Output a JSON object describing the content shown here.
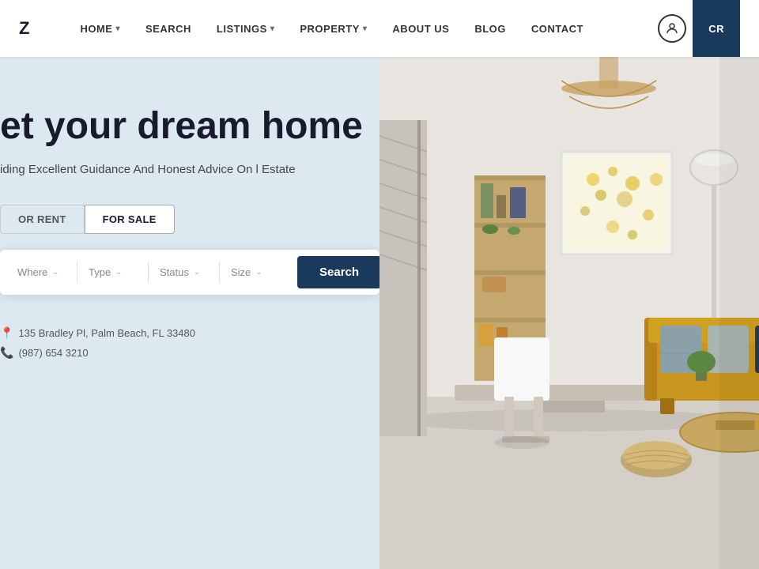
{
  "brand": {
    "logo": "Z"
  },
  "navbar": {
    "links": [
      {
        "label": "HOME",
        "has_dropdown": true,
        "id": "home"
      },
      {
        "label": "SEARCH",
        "has_dropdown": false,
        "id": "search"
      },
      {
        "label": "LISTINGS",
        "has_dropdown": true,
        "id": "listings"
      },
      {
        "label": "PROPERTY",
        "has_dropdown": true,
        "id": "property"
      },
      {
        "label": "ABOUT US",
        "has_dropdown": false,
        "id": "about"
      },
      {
        "label": "BLOG",
        "has_dropdown": false,
        "id": "blog"
      },
      {
        "label": "CONTACT",
        "has_dropdown": false,
        "id": "contact"
      }
    ],
    "cta_label": "CR"
  },
  "hero": {
    "title": "et your dream home",
    "subtitle": "iding Excellent Guidance And Honest Advice On\nl Estate",
    "tabs": [
      {
        "label": "OR RENT",
        "active": false,
        "id": "rent"
      },
      {
        "label": "FOR SALE",
        "active": true,
        "id": "sale"
      }
    ],
    "search": {
      "fields": [
        {
          "label": "Where",
          "id": "where"
        },
        {
          "label": "Type",
          "id": "type"
        },
        {
          "label": "Status",
          "id": "status"
        },
        {
          "label": "Size",
          "id": "size"
        }
      ],
      "button_label": "Search"
    },
    "contact": {
      "address": "135 Bradley Pl, Palm Beach, FL 33480",
      "phone": "(987) 654 3210"
    }
  },
  "colors": {
    "nav_cta_bg": "#1a3a5c",
    "search_btn_bg": "#1a3a5c",
    "hero_left_bg": "#dce9f0",
    "title_color": "#1a1a2e"
  }
}
